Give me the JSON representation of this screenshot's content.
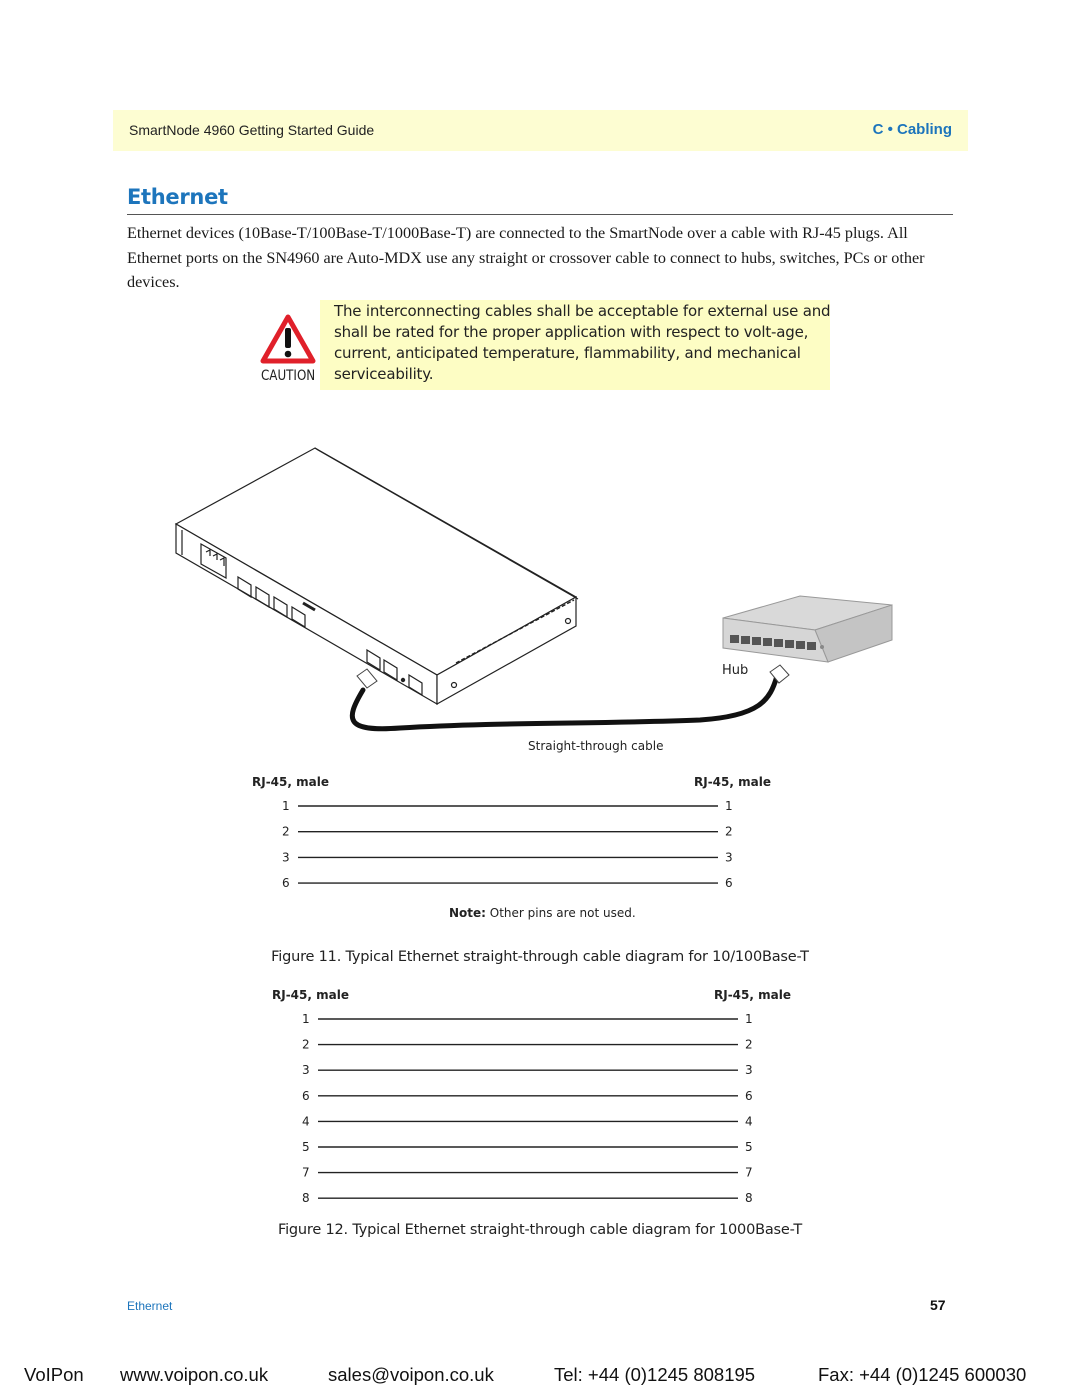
{
  "header": {
    "guide_title": "SmartNode 4960 Getting Started Guide",
    "chapter": "C • Cabling"
  },
  "section": {
    "title": "Ethernet",
    "paragraph": "Ethernet devices (10Base-T/100Base-T/1000Base-T) are connected to the SmartNode over a cable with RJ-45 plugs. All Ethernet ports on the SN4960 are Auto-MDX use any straight or crossover cable to connect to hubs, switches, PCs or other devices."
  },
  "caution": {
    "label": "CAUTION",
    "icon": "warning-triangle-icon",
    "text": "The interconnecting cables shall be acceptable for external use and shall be rated for the proper application with respect to volt-age, current, anticipated temperature, flammability, and mechanical serviceability."
  },
  "illustration": {
    "hub_label": "Hub",
    "cable_label": "Straight-through cable"
  },
  "figure11": {
    "left_header": "RJ-45, male",
    "right_header": "RJ-45, male",
    "pins": [
      "1",
      "2",
      "3",
      "6"
    ],
    "note_bold": "Note:",
    "note_text": " Other pins are not used.",
    "caption": "Figure 11. Typical Ethernet straight-through cable diagram for 10/100Base-T"
  },
  "figure12": {
    "left_header": "RJ-45, male",
    "right_header": "RJ-45, male",
    "pins": [
      "1",
      "2",
      "3",
      "6",
      "4",
      "5",
      "7",
      "8"
    ],
    "caption": "Figure 12. Typical Ethernet straight-through cable diagram for 1000Base-T"
  },
  "footer": {
    "section_name": "Ethernet",
    "page_number": "57"
  },
  "contact": {
    "company": "VoIPon",
    "website": "www.voipon.co.uk",
    "email": "sales@voipon.co.uk",
    "tel": "Tel: +44 (0)1245 808195",
    "fax": "Fax: +44 (0)1245 600030"
  },
  "colors": {
    "accent_blue": "#1d75bc",
    "header_band": "#fdfdd2",
    "caution_box": "#fdfdc4",
    "caution_red": "#e0202a"
  }
}
